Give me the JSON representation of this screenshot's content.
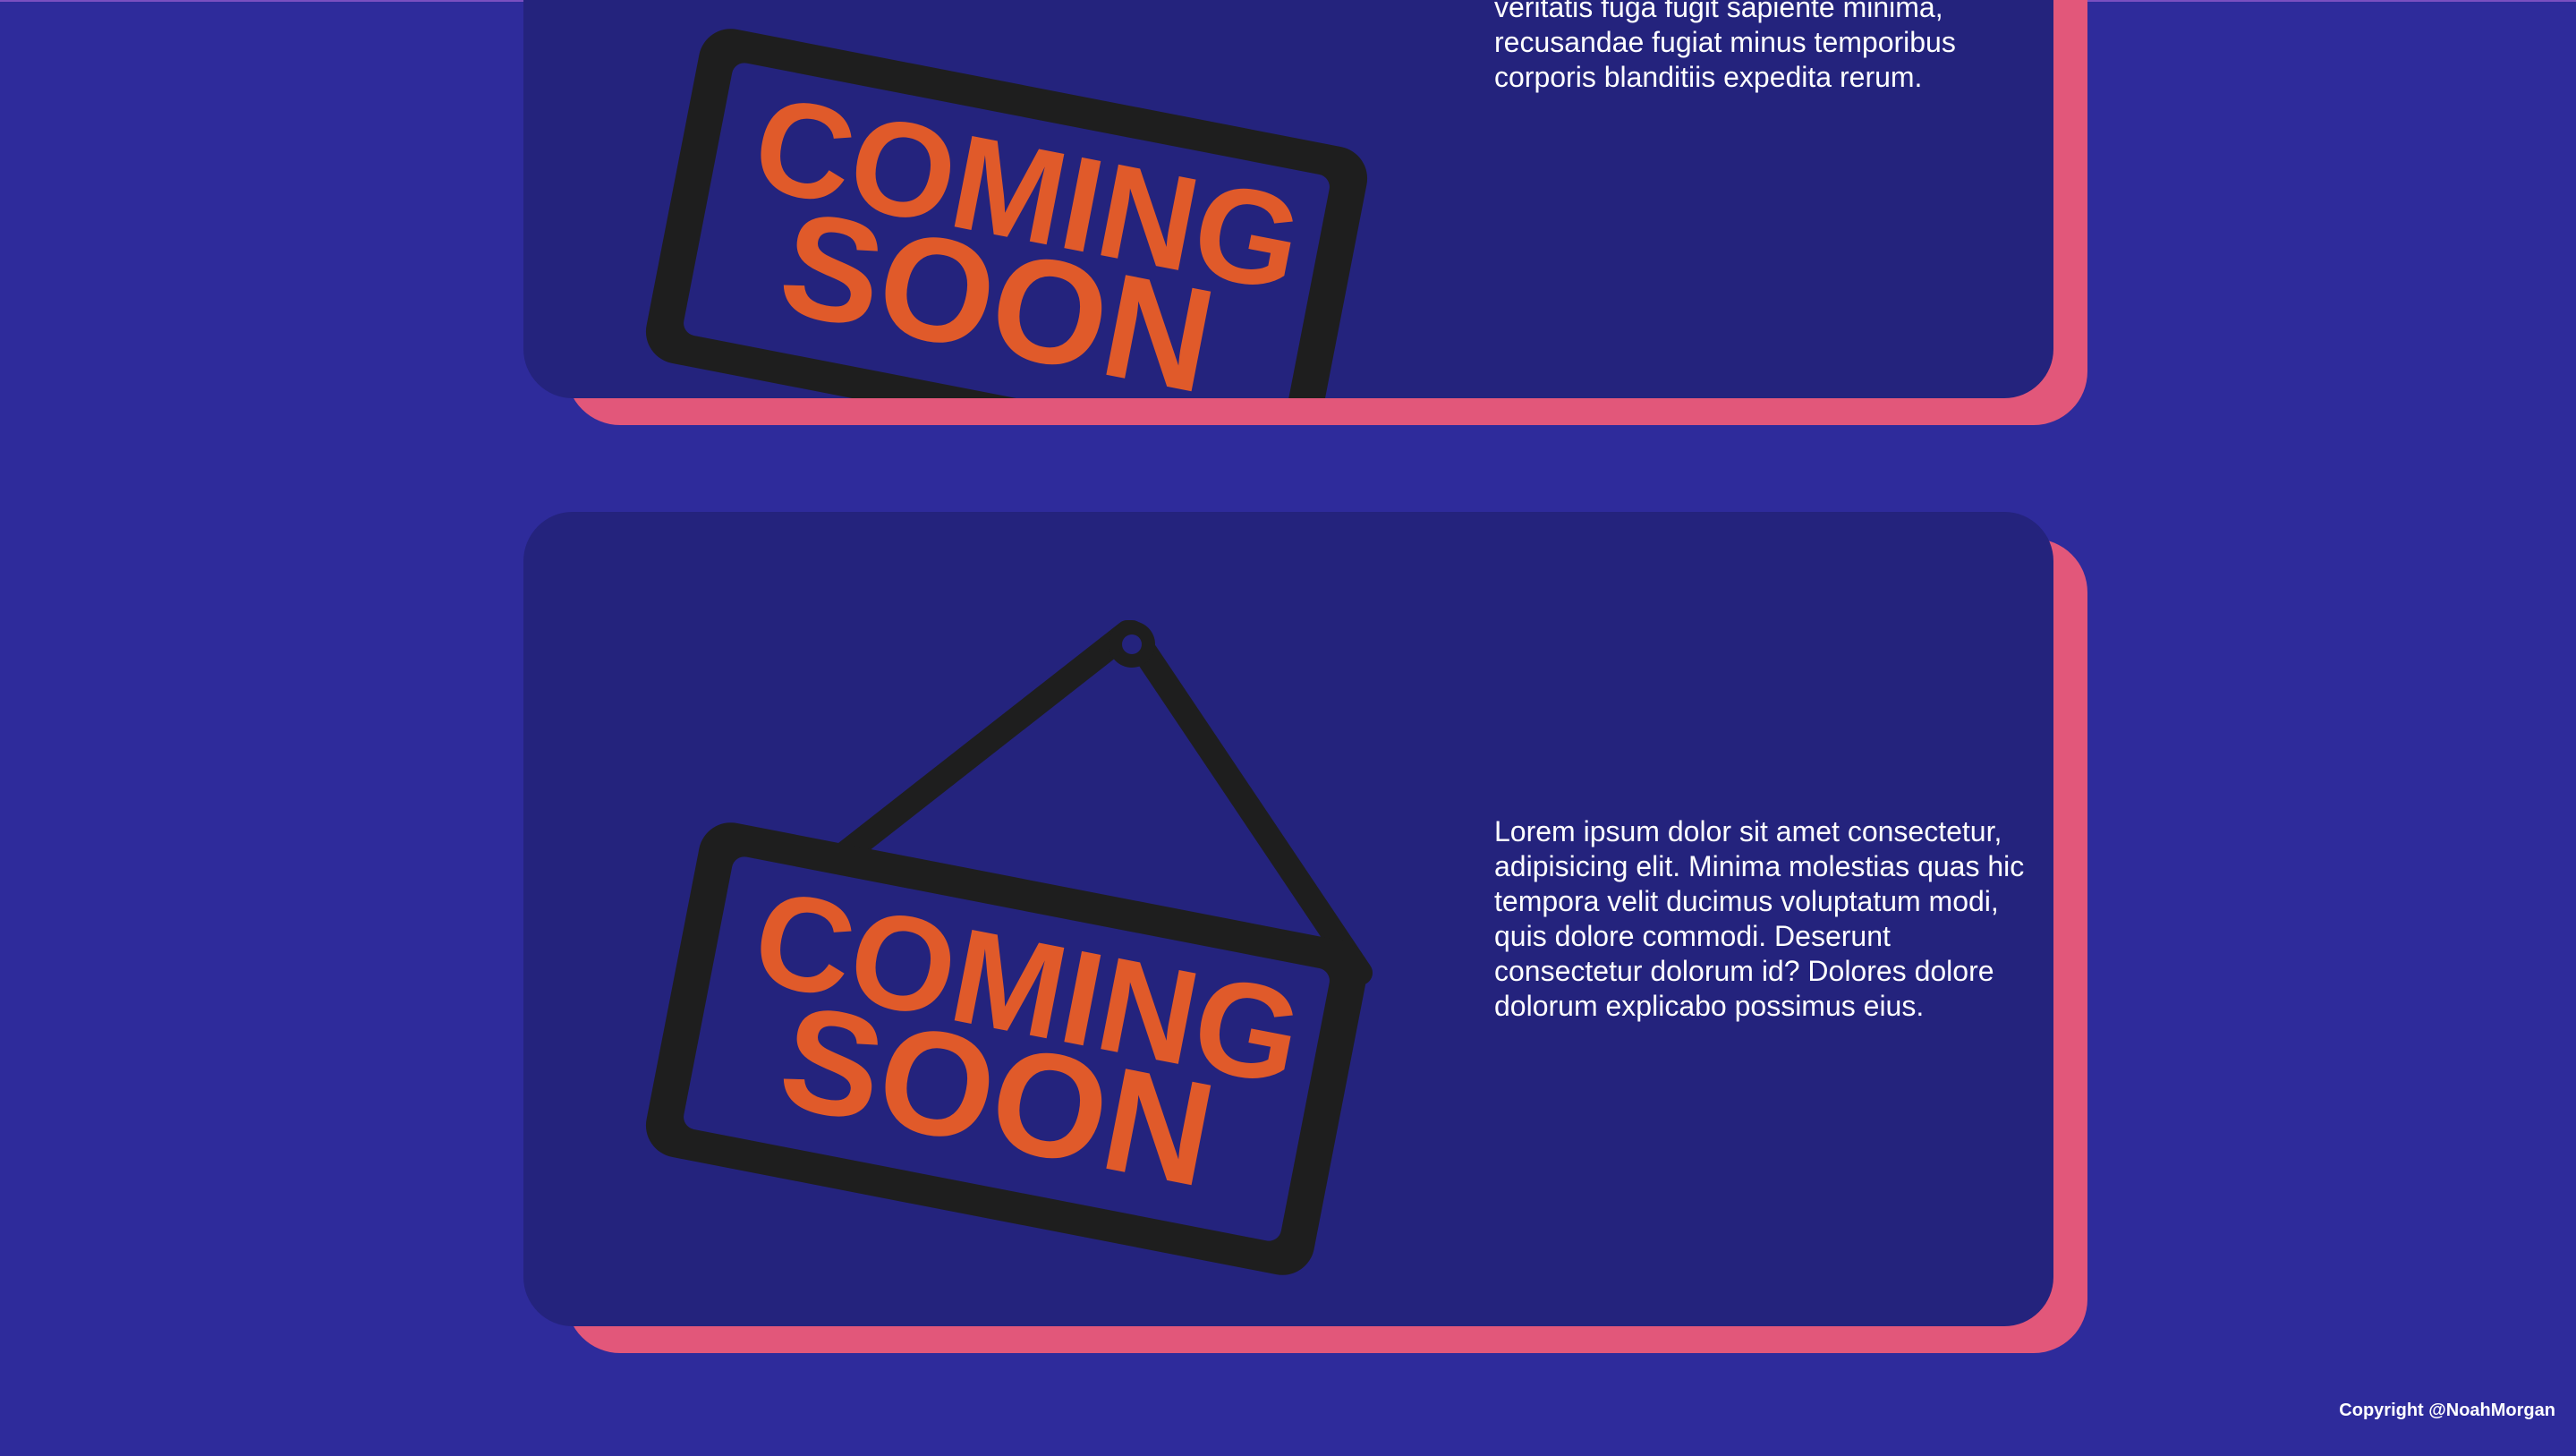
{
  "cards": [
    {
      "sign_line1": "COMING",
      "sign_line2": "SOON",
      "text": "veritatis fuga fugit sapiente minima, recusandae fugiat minus temporibus corporis blanditiis expedita rerum."
    },
    {
      "sign_line1": "COMING",
      "sign_line2": "SOON",
      "text": "Lorem ipsum dolor sit amet consectetur, adipisicing elit. Minima molestias quas hic tempora velit ducimus voluptatum modi, quis dolore commodi. Deserunt consectetur dolorum id? Dolores dolore dolorum explicabo possimus eius."
    }
  ],
  "footer": {
    "copyright": "Copyright @NoahMorgan"
  },
  "colors": {
    "page_background": "#2e2b9b",
    "card_background": "#24237d",
    "card_shadow": "#e2577a",
    "sign_frame": "#1e1e1e",
    "sign_text": "#e05a2a",
    "body_text": "#ffffff"
  }
}
